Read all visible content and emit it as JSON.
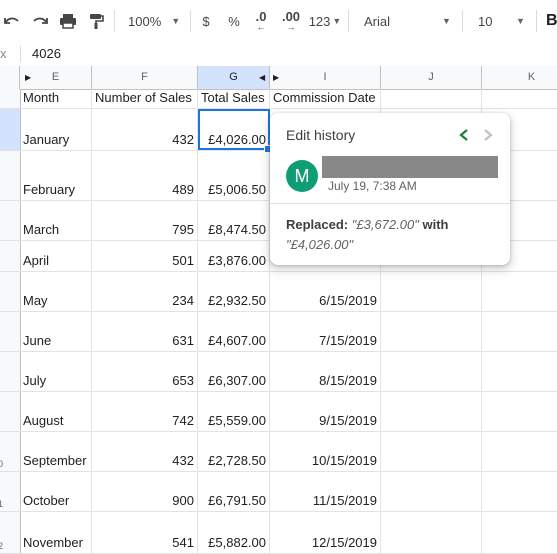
{
  "toolbar": {
    "zoom": "100%",
    "currency_symbol": "$",
    "percent_symbol": "%",
    "decrease_decimal": ".0",
    "increase_decimal": ".00",
    "more_formats": "123",
    "font_family": "Arial",
    "font_size": "10",
    "bold_label": "B"
  },
  "formula_bar": {
    "close_glyph": "x",
    "value": "4026"
  },
  "columns": [
    {
      "letter": "E"
    },
    {
      "letter": "F"
    },
    {
      "letter": "G"
    },
    {
      "letter": "I"
    },
    {
      "letter": "J"
    },
    {
      "letter": "K"
    }
  ],
  "row_numbers": [
    "",
    "",
    "",
    "",
    "",
    "",
    "",
    "",
    "0",
    "1",
    "2"
  ],
  "sheet": {
    "headers": [
      "Month",
      "Number of Sales",
      "Total Sales",
      "Commission Date"
    ],
    "rows": [
      {
        "month": "January",
        "sales": "432",
        "total": "£4,026.00",
        "date": ""
      },
      {
        "month": "February",
        "sales": "489",
        "total": "£5,006.50",
        "date": ""
      },
      {
        "month": "March",
        "sales": "795",
        "total": "£8,474.50",
        "date": ""
      },
      {
        "month": "April",
        "sales": "501",
        "total": "£3,876.00",
        "date": ""
      },
      {
        "month": "May",
        "sales": "234",
        "total": "£2,932.50",
        "date": "6/15/2019"
      },
      {
        "month": "June",
        "sales": "631",
        "total": "£4,607.00",
        "date": "7/15/2019"
      },
      {
        "month": "July",
        "sales": "653",
        "total": "£6,307.00",
        "date": "8/15/2019"
      },
      {
        "month": "August",
        "sales": "742",
        "total": "£5,559.00",
        "date": "9/15/2019"
      },
      {
        "month": "September",
        "sales": "432",
        "total": "£2,728.50",
        "date": "10/15/2019"
      },
      {
        "month": "October",
        "sales": "900",
        "total": "£6,791.50",
        "date": "11/15/2019"
      },
      {
        "month": "November",
        "sales": "541",
        "total": "£5,882.00",
        "date": "12/15/2019"
      }
    ]
  },
  "edit_history": {
    "title": "Edit history",
    "avatar_initial": "M",
    "timestamp": "July 19, 7:38 AM",
    "action": "Replaced:",
    "old_value": "\"£3,672.00\"",
    "connector": "with",
    "new_value": "\"£4,026.00\""
  },
  "colors": {
    "accent": "#1a73e8",
    "avatar": "#0f9d75",
    "nav_active": "#188038",
    "selected_header": "#d3e3fd"
  }
}
